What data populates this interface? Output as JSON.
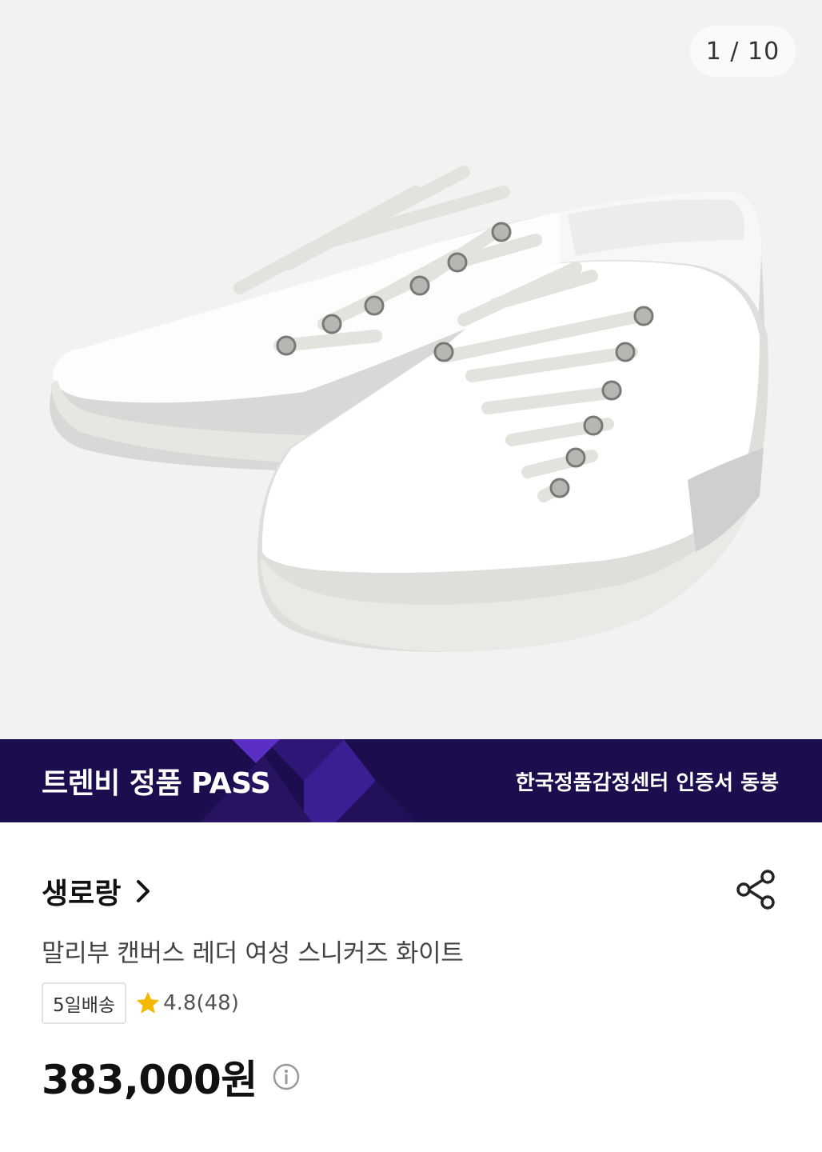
{
  "gallery": {
    "counter": "1 / 10",
    "image_subject": "white canvas low-top lace-up sneakers"
  },
  "banner": {
    "left_text": "트렌비 정품 PASS",
    "right_text": "한국정품감정센터 인증서 동봉",
    "background_color": "#1c0d4f",
    "accent_color": "#5b2fc4"
  },
  "product": {
    "brand": "생로랑",
    "title": "말리부 캔버스 레더 여성 스니커즈 화이트",
    "delivery_tag": "5일배송",
    "rating": "4.8(48)",
    "price": "383,000원"
  },
  "icons": {
    "brand_link": "chevron-right-icon",
    "share": "share-icon",
    "rating": "star-icon",
    "price_info": "info-icon"
  },
  "colors": {
    "star": "#f5b800",
    "text_primary": "#111111",
    "text_secondary": "#444444"
  }
}
